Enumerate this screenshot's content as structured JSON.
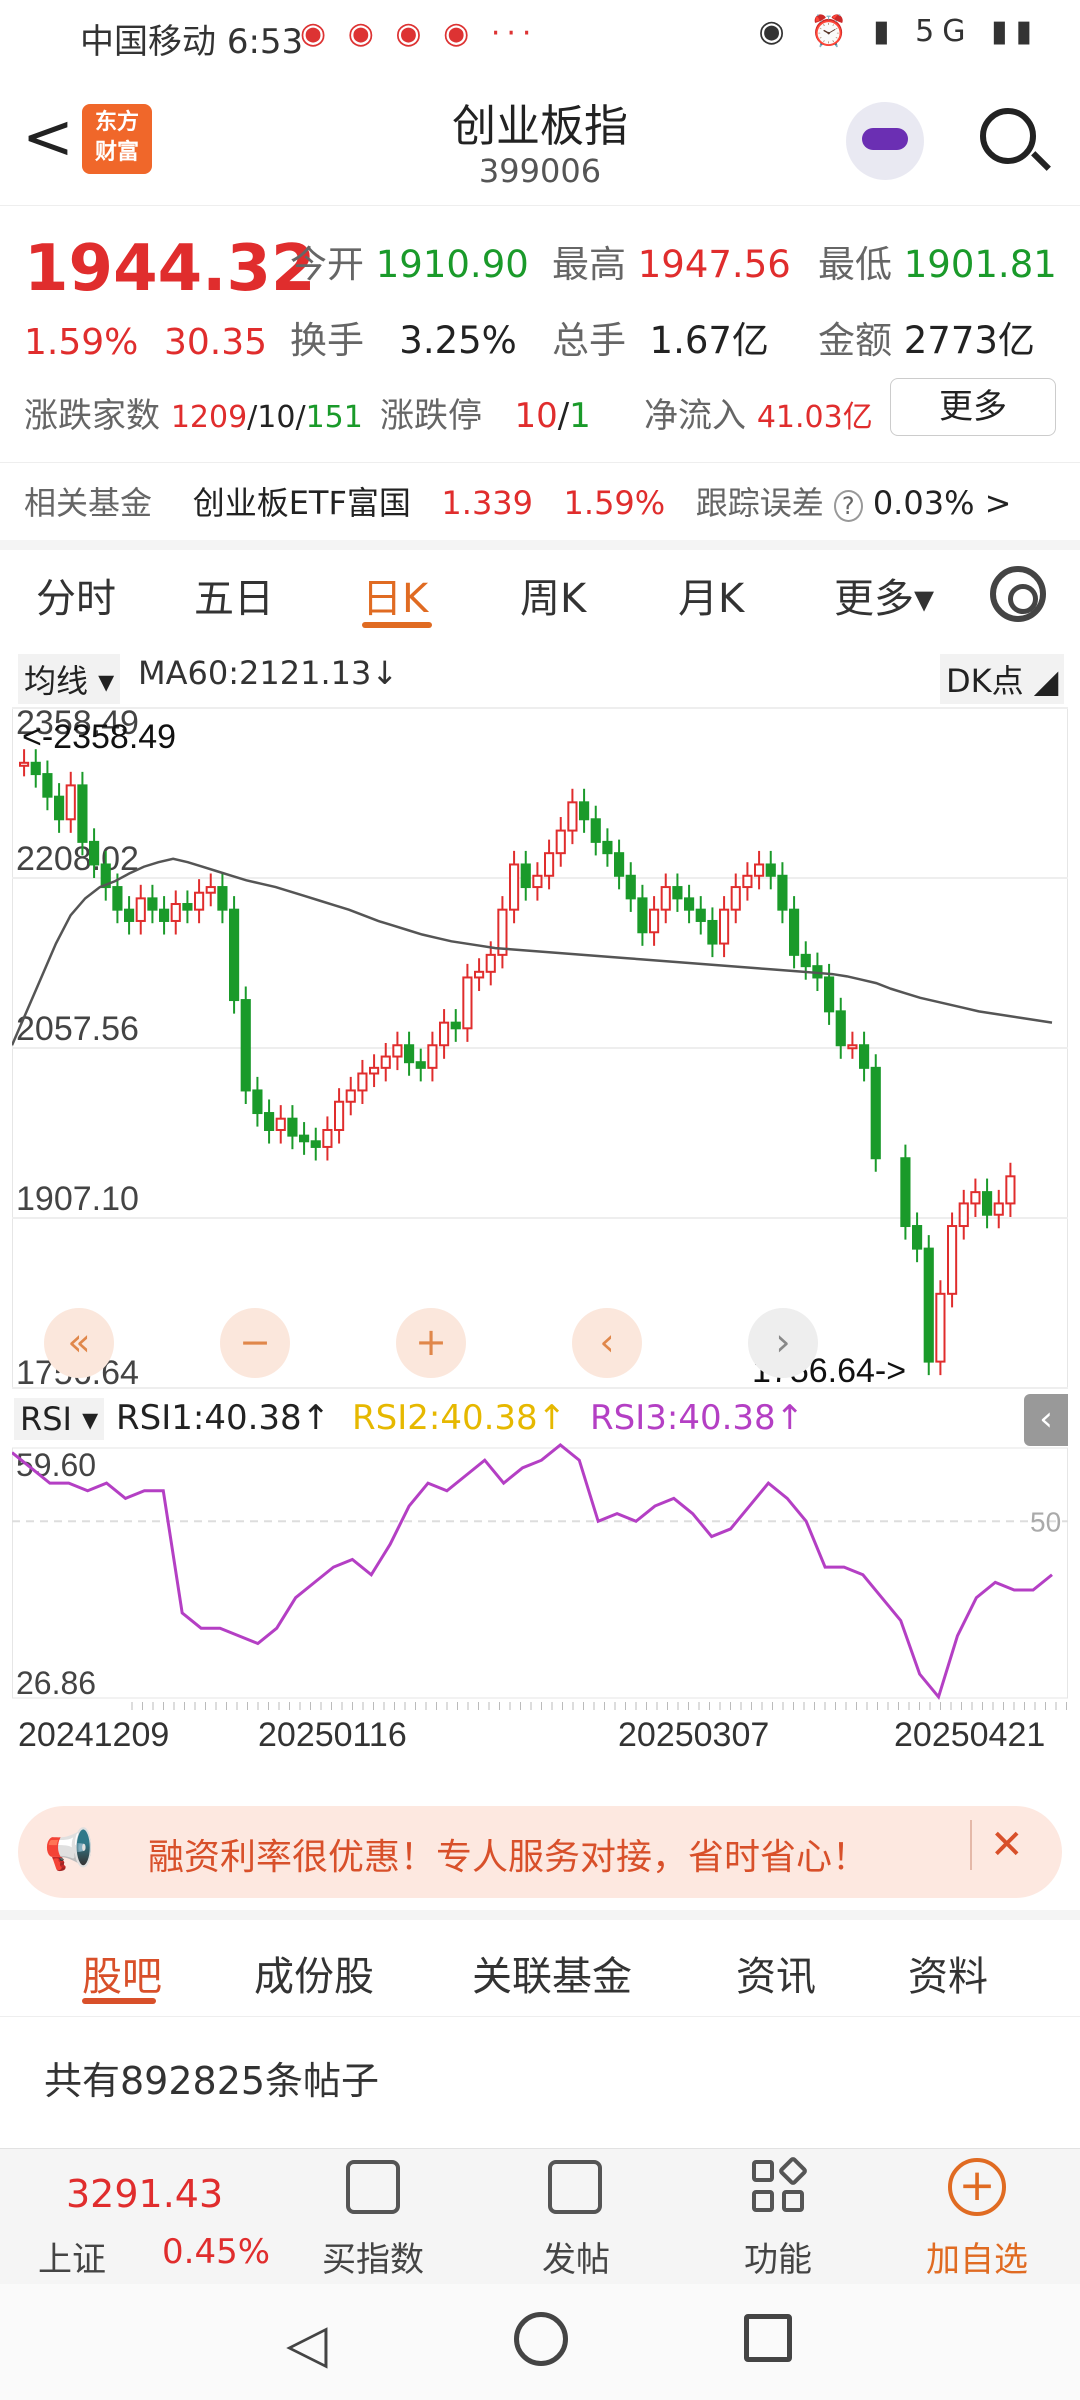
{
  "status_bar": {
    "carrier": "中国移动",
    "time": "6:53",
    "more": "···",
    "right_icons": "◉ ⏰ ▮ 5G ▮▮"
  },
  "header": {
    "back": "<",
    "logo": "东方\n财富",
    "title": "创业板指",
    "code": "399006"
  },
  "quote": {
    "price": "1944.32",
    "change_pct": "1.59%",
    "change_pts": "30.35",
    "open_label": "今开",
    "open": "1910.90",
    "high_label": "最高",
    "high": "1947.56",
    "low_label": "最低",
    "low": "1901.81",
    "turnover_label": "换手",
    "turnover": "3.25%",
    "volume_label": "总手",
    "volume": "1.67亿",
    "amount_label": "金额",
    "amount": "2773亿",
    "breadth_label": "涨跌家数",
    "up": "1209",
    "sep1": "/",
    "flat": "10",
    "sep2": "/",
    "down": "151",
    "limit_label": "涨跌停",
    "limit_up": "10",
    "limit_sep": "/",
    "limit_down": "1",
    "netflow_label": "净流入",
    "netflow": "41.03亿",
    "more_btn": "更多"
  },
  "fund": {
    "label": "相关基金",
    "name": "创业板ETF富国",
    "price": "1.339",
    "pct": "1.59%",
    "err_label": "跟踪误差",
    "help": "?",
    "err": "0.03%",
    "arrow": ">"
  },
  "chart_tabs": [
    {
      "label": "分时"
    },
    {
      "label": "五日"
    },
    {
      "label": "日K"
    },
    {
      "label": "周K"
    },
    {
      "label": "月K"
    },
    {
      "label": "更多▾"
    }
  ],
  "chart_top": {
    "ma_select": "均线 ▾",
    "ma_text": "MA60:2121.13↓",
    "dk": "DK点 ◢"
  },
  "chart_data": {
    "type": "candlestick",
    "y_ticks": [
      "2358.49",
      "2208.02",
      "2057.56",
      "1907.10",
      "1756.64"
    ],
    "ylim": [
      1756.64,
      2358.49
    ],
    "max_label": "<-2358.49",
    "min_label": "1756.64->",
    "x_dates": [
      "20241209",
      "20250116",
      "20250307",
      "20250421"
    ],
    "closes": [
      2310,
      2300,
      2280,
      2260,
      2290,
      2240,
      2220,
      2200,
      2180,
      2170,
      2190,
      2180,
      2170,
      2185,
      2180,
      2195,
      2200,
      2180,
      2100,
      2020,
      2000,
      1985,
      1995,
      1980,
      1975,
      1970,
      1985,
      2010,
      2020,
      2035,
      2040,
      2050,
      2060,
      2045,
      2040,
      2060,
      2080,
      2075,
      2120,
      2125,
      2140,
      2180,
      2220,
      2200,
      2210,
      2230,
      2250,
      2275,
      2260,
      2240,
      2230,
      2210,
      2190,
      2160,
      2180,
      2200,
      2190,
      2180,
      2170,
      2150,
      2180,
      2200,
      2210,
      2220,
      2210,
      2180,
      2140,
      2130,
      2120,
      2090,
      2060,
      2060,
      2040,
      1960,
      1900,
      1880,
      1780,
      1840,
      1900,
      1920,
      1930,
      1910,
      1920,
      1944
    ],
    "ma60": [
      2060,
      2090,
      2120,
      2150,
      2175,
      2190,
      2200,
      2205,
      2212,
      2218,
      2222,
      2225,
      2222,
      2218,
      2214,
      2210,
      2206,
      2203,
      2200,
      2196,
      2192,
      2188,
      2184,
      2180,
      2175,
      2170,
      2166,
      2162,
      2158,
      2155,
      2152,
      2150,
      2148,
      2146,
      2145,
      2144,
      2143,
      2142,
      2141,
      2140,
      2139,
      2138,
      2137,
      2136,
      2135,
      2134,
      2133,
      2132,
      2131,
      2130,
      2129,
      2128,
      2127,
      2126,
      2125,
      2124,
      2123,
      2121,
      2118,
      2115,
      2110,
      2106,
      2102,
      2099,
      2096,
      2093,
      2090,
      2088,
      2086,
      2084,
      2082,
      2080
    ],
    "rsi_ticks": [
      "59.60",
      "26.86"
    ],
    "rsi_mid": "50",
    "rsi": [
      59,
      57,
      55,
      55,
      54,
      55,
      53,
      54,
      54,
      38,
      36,
      36,
      35,
      34,
      36,
      40,
      42,
      44,
      45,
      43,
      47,
      52,
      55,
      54,
      56,
      58,
      55,
      57,
      58,
      60,
      58,
      50,
      51,
      50,
      52,
      53,
      51,
      48,
      49,
      52,
      55,
      53,
      50,
      44,
      44,
      43,
      40,
      37,
      30,
      27,
      35,
      40,
      42,
      41,
      41,
      43
    ]
  },
  "rsi_header": {
    "select": "RSI ▾",
    "rsi1": "RSI1:40.38↑",
    "rsi2": "RSI2:40.38↑",
    "rsi3": "RSI3:40.38↑"
  },
  "controls": [
    "«",
    "−",
    "+",
    "‹",
    "›"
  ],
  "banner": {
    "text": "融资利率很优惠！专人服务对接，省时省心！",
    "close": "✕"
  },
  "bottom_tabs": [
    {
      "label": "股吧"
    },
    {
      "label": "成份股"
    },
    {
      "label": "关联基金"
    },
    {
      "label": "资讯"
    },
    {
      "label": "资料"
    }
  ],
  "posts": "共有892825条帖子",
  "toolbar": {
    "sh_value": "3291.43",
    "sh_label": "上证",
    "sh_pct": "0.45%",
    "buy": "买指数",
    "post": "发帖",
    "func": "功能",
    "add": "加自选"
  },
  "colors": {
    "up": "#e02d2d",
    "down": "#1a9a2a",
    "accent": "#e06b22",
    "rsi1": "#222222",
    "rsi2": "#e6b800",
    "rsi3": "#b43fc4"
  }
}
